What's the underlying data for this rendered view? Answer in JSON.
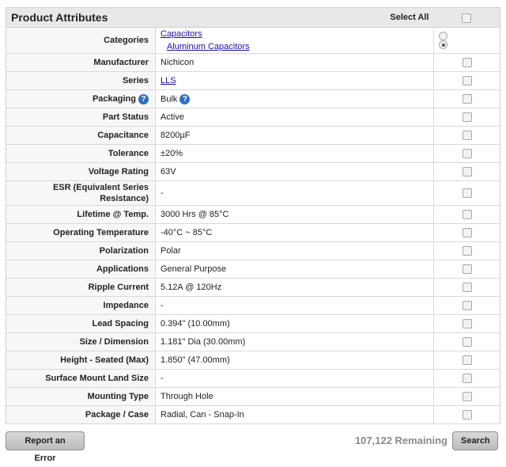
{
  "header": {
    "title": "Product Attributes",
    "select_all": "Select All"
  },
  "categories": {
    "label": "Categories",
    "items": [
      {
        "label": "Capacitors",
        "selected": false
      },
      {
        "label": "Aluminum Capacitors",
        "selected": true
      }
    ]
  },
  "rows": [
    {
      "label": "Manufacturer",
      "value": "Nichicon",
      "link": false
    },
    {
      "label": "Series",
      "value": "LLS",
      "link": true
    },
    {
      "label": "Packaging",
      "value": "Bulk",
      "link": false,
      "help": true
    },
    {
      "label": "Part Status",
      "value": "Active",
      "link": false
    },
    {
      "label": "Capacitance",
      "value": "8200µF",
      "link": false
    },
    {
      "label": "Tolerance",
      "value": "±20%",
      "link": false
    },
    {
      "label": "Voltage Rating",
      "value": "63V",
      "link": false
    },
    {
      "label": "ESR (Equivalent Series Resistance)",
      "value": "-",
      "link": false,
      "tall": true
    },
    {
      "label": "Lifetime @ Temp.",
      "value": "3000 Hrs @ 85°C",
      "link": false
    },
    {
      "label": "Operating Temperature",
      "value": "-40°C ~ 85°C",
      "link": false
    },
    {
      "label": "Polarization",
      "value": "Polar",
      "link": false
    },
    {
      "label": "Applications",
      "value": "General Purpose",
      "link": false
    },
    {
      "label": "Ripple Current",
      "value": "5.12A @ 120Hz",
      "link": false
    },
    {
      "label": "Impedance",
      "value": "-",
      "link": false
    },
    {
      "label": "Lead Spacing",
      "value": "0.394\" (10.00mm)",
      "link": false
    },
    {
      "label": "Size / Dimension",
      "value": "1.181\" Dia (30.00mm)",
      "link": false
    },
    {
      "label": "Height - Seated (Max)",
      "value": "1.850\" (47.00mm)",
      "link": false
    },
    {
      "label": "Surface Mount Land Size",
      "value": "-",
      "link": false
    },
    {
      "label": "Mounting Type",
      "value": "Through Hole",
      "link": false
    },
    {
      "label": "Package / Case",
      "value": "Radial, Can - Snap-In",
      "link": false
    }
  ],
  "help_icon": "question-mark-icon",
  "footer": {
    "report_label": "Report an Error",
    "remaining": "107,122 Remaining",
    "search_label": "Search"
  },
  "colors": {
    "link": "#1a0dab",
    "header_bg": "#e8e8e8",
    "help_icon": "#2f6fc0"
  }
}
